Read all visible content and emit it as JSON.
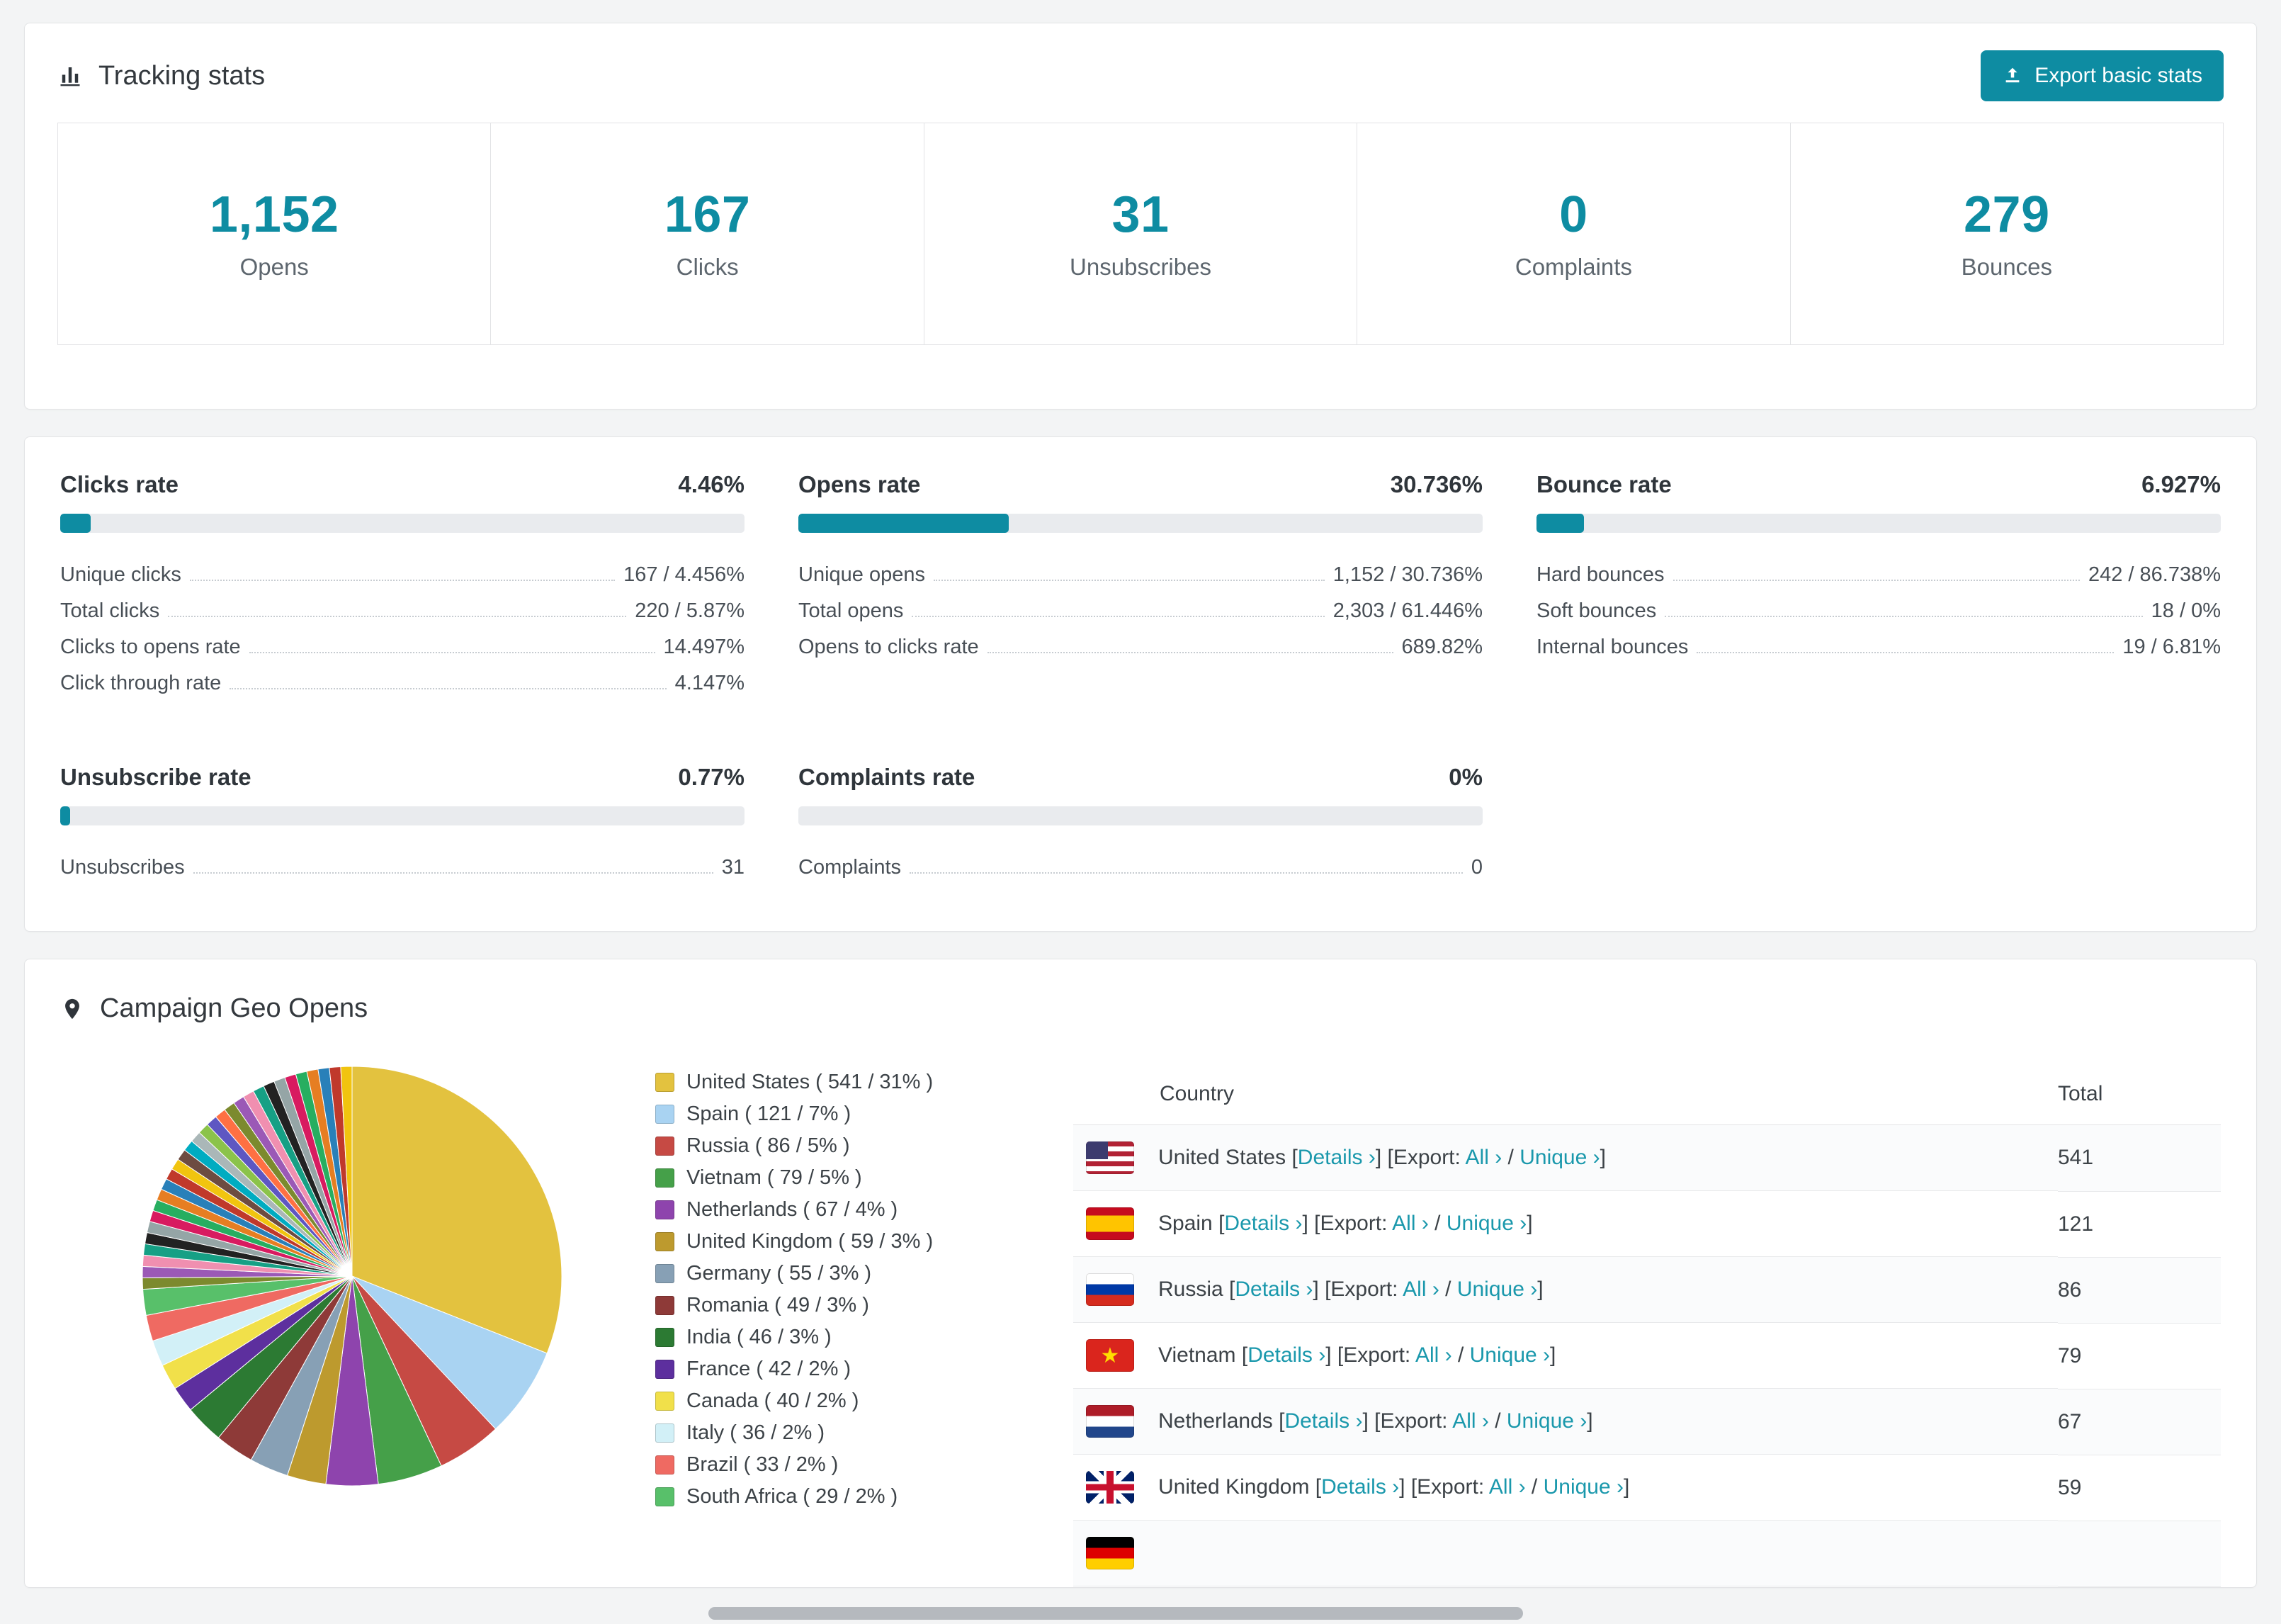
{
  "accent": "#0e8ca2",
  "tracking": {
    "title": "Tracking stats",
    "export_button": "Export basic stats",
    "stats": [
      {
        "value": "1,152",
        "label": "Opens"
      },
      {
        "value": "167",
        "label": "Clicks"
      },
      {
        "value": "31",
        "label": "Unsubscribes"
      },
      {
        "value": "0",
        "label": "Complaints"
      },
      {
        "value": "279",
        "label": "Bounces"
      }
    ]
  },
  "rates": {
    "panels": [
      {
        "id": "clicks",
        "title": "Clicks rate",
        "value": "4.46%",
        "percent": 4.46,
        "rows": [
          [
            "Unique clicks",
            "167 / 4.456%"
          ],
          [
            "Total clicks",
            "220 / 5.87%"
          ],
          [
            "Clicks to opens rate",
            "14.497%"
          ],
          [
            "Click through rate",
            "4.147%"
          ]
        ]
      },
      {
        "id": "opens",
        "title": "Opens rate",
        "value": "30.736%",
        "percent": 30.736,
        "rows": [
          [
            "Unique opens",
            "1,152 / 30.736%"
          ],
          [
            "Total opens",
            "2,303 / 61.446%"
          ],
          [
            "Opens to clicks rate",
            "689.82%"
          ]
        ]
      },
      {
        "id": "bounce",
        "title": "Bounce rate",
        "value": "6.927%",
        "percent": 6.927,
        "rows": [
          [
            "Hard bounces",
            "242 / 86.738%"
          ],
          [
            "Soft bounces",
            "18 / 0%"
          ],
          [
            "Internal bounces",
            "19 / 6.81%"
          ]
        ]
      },
      {
        "id": "unsubscribe",
        "title": "Unsubscribe rate",
        "value": "0.77%",
        "percent": 0.77,
        "rows": [
          [
            "Unsubscribes",
            "31"
          ]
        ]
      },
      {
        "id": "complaints",
        "title": "Complaints rate",
        "value": "0%",
        "percent": 0,
        "rows": [
          [
            "Complaints",
            "0"
          ]
        ]
      }
    ]
  },
  "geo": {
    "title": "Campaign Geo Opens",
    "chart_data": {
      "type": "pie",
      "title": "Campaign Geo Opens",
      "legend_position": "right",
      "slices": [
        {
          "label": "United States",
          "value": 541,
          "percent": 31,
          "color": "#e3c23f",
          "flag": "us"
        },
        {
          "label": "Spain",
          "value": 121,
          "percent": 7,
          "color": "#a9d3f2",
          "flag": "es"
        },
        {
          "label": "Russia",
          "value": 86,
          "percent": 5,
          "color": "#c64a44",
          "flag": "ru"
        },
        {
          "label": "Vietnam",
          "value": 79,
          "percent": 5,
          "color": "#45a049",
          "flag": "vn"
        },
        {
          "label": "Netherlands",
          "value": 67,
          "percent": 4,
          "color": "#8e44ad",
          "flag": "nl"
        },
        {
          "label": "United Kingdom",
          "value": 59,
          "percent": 3,
          "color": "#bd9a2e",
          "flag": "gb"
        },
        {
          "label": "Germany",
          "value": 55,
          "percent": 3,
          "color": "#87a0b5",
          "flag": "de"
        },
        {
          "label": "Romania",
          "value": 49,
          "percent": 3,
          "color": "#8e3a38"
        },
        {
          "label": "India",
          "value": 46,
          "percent": 3,
          "color": "#2c7a33"
        },
        {
          "label": "France",
          "value": 42,
          "percent": 2,
          "color": "#5d2f9e"
        },
        {
          "label": "Canada",
          "value": 40,
          "percent": 2,
          "color": "#f1e04a"
        },
        {
          "label": "Italy",
          "value": 36,
          "percent": 2,
          "color": "#d2f0f7"
        },
        {
          "label": "Brazil",
          "value": 33,
          "percent": 2,
          "color": "#ef6a62"
        },
        {
          "label": "South Africa",
          "value": 29,
          "percent": 2,
          "color": "#58c06a"
        }
      ],
      "other_slices": {
        "percent_total": 26,
        "count": 30,
        "palette": [
          "#7c8a2e",
          "#9b59b6",
          "#f08fb0",
          "#16a085",
          "#222222",
          "#95a5a6",
          "#d81b60",
          "#27ae60",
          "#e67e22",
          "#2980b9",
          "#c0392b",
          "#f1c40f",
          "#6d4c41",
          "#00acc1",
          "#aab7b8",
          "#8bc34a",
          "#5e57c2",
          "#ff7043"
        ]
      }
    },
    "table": {
      "columns": [
        "Country",
        "Total"
      ],
      "link_details": "Details",
      "export_label": "Export:",
      "link_all": "All",
      "link_unique": "Unique",
      "arrow": "›",
      "rows": [
        {
          "country": "United States",
          "total": "541",
          "flag": "us"
        },
        {
          "country": "Spain",
          "total": "121",
          "flag": "es"
        },
        {
          "country": "Russia",
          "total": "86",
          "flag": "ru"
        },
        {
          "country": "Vietnam",
          "total": "79",
          "flag": "vn"
        },
        {
          "country": "Netherlands",
          "total": "67",
          "flag": "nl"
        },
        {
          "country": "United Kingdom",
          "total": "59",
          "flag": "gb"
        },
        {
          "country": "",
          "total": "",
          "flag": "de",
          "partial": true
        }
      ]
    }
  }
}
